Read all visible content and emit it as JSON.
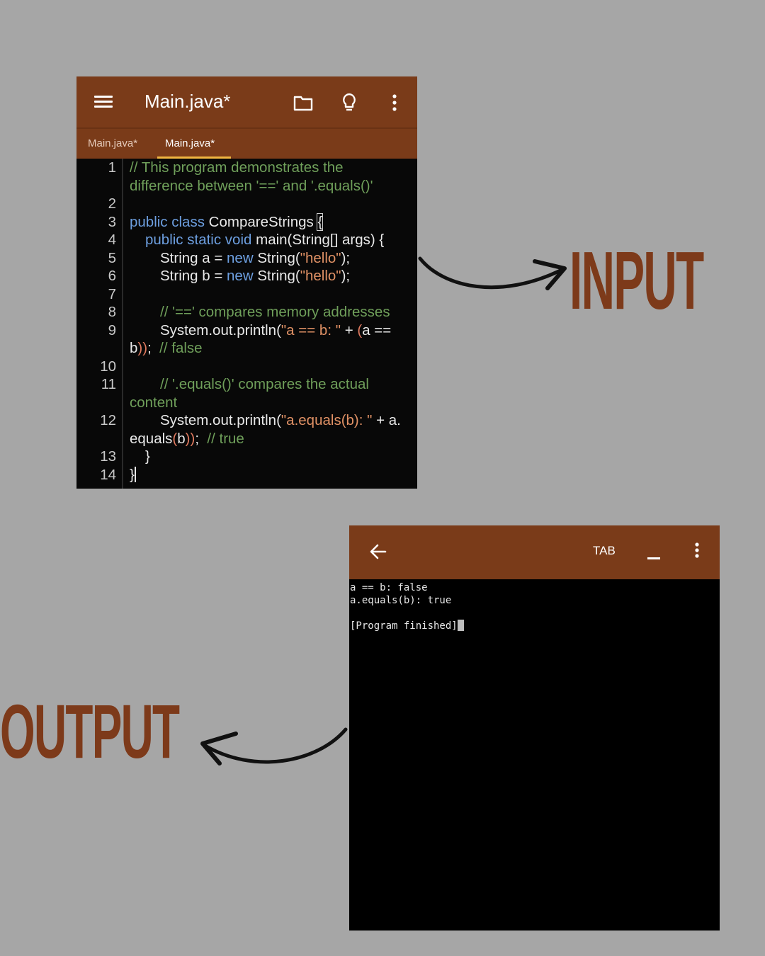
{
  "editor": {
    "title": "Main.java*",
    "icons": [
      "menu-icon",
      "folder-icon",
      "lightbulb-icon",
      "more-vert-icon"
    ],
    "tabs": [
      {
        "label": "Main.java*",
        "active": false
      },
      {
        "label": "Main.java*",
        "active": true
      }
    ],
    "line_numbers": [
      "1",
      "2",
      "3",
      "4",
      "5",
      "6",
      "7",
      "8",
      "9",
      "10",
      "11",
      "12",
      "13",
      "14"
    ],
    "code": {
      "l1a": "// This program demonstrates the",
      "l1b": "difference between '==' and '.equals()'",
      "l3_kw": "public class",
      "l3_name": " CompareStrings ",
      "l3_brace": "{",
      "l4_kw": "public static void",
      "l4_rest": " main(String[] args) {",
      "l5_a": "String a = ",
      "l5_kw": "new",
      "l5_b": " String(",
      "l5_str": "\"hello\"",
      "l5_c": ");",
      "l6_a": "String b = ",
      "l6_kw": "new",
      "l6_b": " String(",
      "l6_str": "\"hello\"",
      "l6_c": ");",
      "l8": "// '==' compares memory addresses",
      "l9_a": "System.out.println(",
      "l9_str": "\"a == b: \"",
      "l9_b": " + ",
      "l9_p": "(",
      "l9_c": "a ==",
      "l9w_a": "b",
      "l9w_p": "))",
      "l9w_b": ";  ",
      "l9w_cm": "// false",
      "l11a": "// '.equals()' compares the actual",
      "l11b": "content",
      "l12_a": "System.out.println(",
      "l12_str": "\"a.equals(b): \"",
      "l12_b": " + a.",
      "l12w_a": "equals",
      "l12w_p1": "(",
      "l12w_b": "b",
      "l12w_p2": "))",
      "l12w_c": ";  ",
      "l12w_cm": "// true",
      "l13": "}",
      "l14": "}"
    },
    "colors": {
      "toolbar": "#7a3b19",
      "keyword": "#6d9fe0",
      "comment": "#6f9f5a",
      "string": "#e09165",
      "tab_indicator": "#f1b641"
    }
  },
  "labels": {
    "input": "INPUT",
    "output": "OUTPUT"
  },
  "terminal": {
    "tab_key": "TAB",
    "icons": [
      "back-arrow-icon",
      "underscore-key",
      "more-vert-icon"
    ],
    "output_lines": [
      "a == b: false",
      "a.equals(b): true",
      "",
      "[Program finished]"
    ]
  }
}
